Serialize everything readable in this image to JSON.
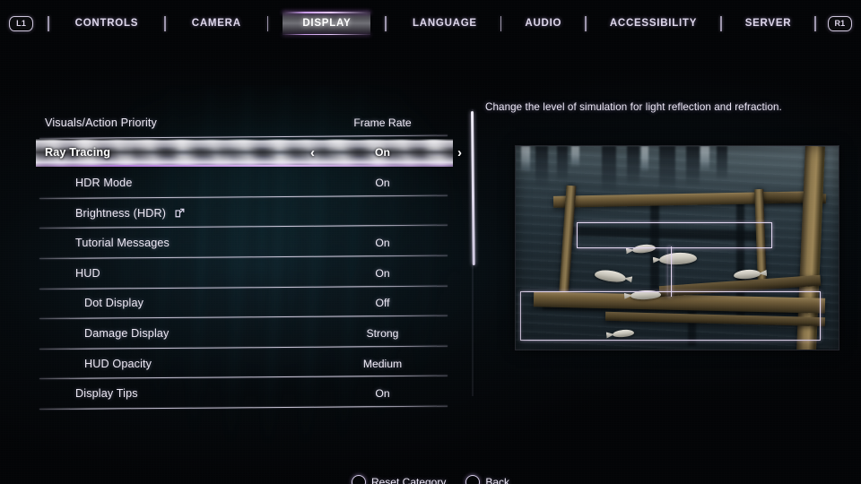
{
  "nav": {
    "left_bumper": "L1",
    "right_bumper": "R1",
    "tabs": [
      {
        "label": "CONTROLS",
        "active": false
      },
      {
        "label": "CAMERA",
        "active": false
      },
      {
        "label": "DISPLAY",
        "active": true
      },
      {
        "label": "LANGUAGE",
        "active": false
      },
      {
        "label": "AUDIO",
        "active": false
      },
      {
        "label": "ACCESSIBILITY",
        "active": false
      },
      {
        "label": "SERVER",
        "active": false
      }
    ]
  },
  "settings": {
    "rows": [
      {
        "label": "Visuals/Action Priority",
        "value": "Frame Rate",
        "indent": 0,
        "selected": false,
        "external_link": false
      },
      {
        "label": "Ray Tracing",
        "value": "On",
        "indent": 0,
        "selected": true,
        "external_link": false
      },
      {
        "label": "HDR Mode",
        "value": "On",
        "indent": 1,
        "selected": false,
        "external_link": false
      },
      {
        "label": "Brightness (HDR)",
        "value": "",
        "indent": 1,
        "selected": false,
        "external_link": true
      },
      {
        "label": "Tutorial Messages",
        "value": "On",
        "indent": 1,
        "selected": false,
        "external_link": false
      },
      {
        "label": "HUD",
        "value": "On",
        "indent": 1,
        "selected": false,
        "external_link": false
      },
      {
        "label": "Dot Display",
        "value": "Off",
        "indent": 2,
        "selected": false,
        "external_link": false
      },
      {
        "label": "Damage Display",
        "value": "Strong",
        "indent": 2,
        "selected": false,
        "external_link": false
      },
      {
        "label": "HUD Opacity",
        "value": "Medium",
        "indent": 2,
        "selected": false,
        "external_link": false
      },
      {
        "label": "Display Tips",
        "value": "On",
        "indent": 1,
        "selected": false,
        "external_link": false
      }
    ],
    "prev_arrow": "‹",
    "next_arrow": "›"
  },
  "detail": {
    "description": "Change the level of simulation for light reflection and refraction."
  },
  "footer": {
    "reset_label": "Reset Category",
    "back_label": "Back"
  },
  "colors": {
    "accent": "#c79ae6",
    "text": "#ece8f4",
    "background": "#030406",
    "rule": "#e0dae e"
  }
}
